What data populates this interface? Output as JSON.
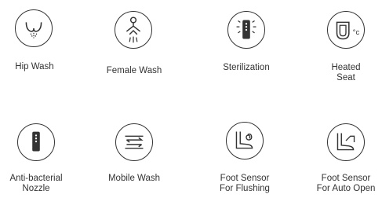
{
  "features": [
    {
      "icon": "hip-wash-icon",
      "label": "Hip Wash"
    },
    {
      "icon": "female-wash-icon",
      "label": "Female Wash"
    },
    {
      "icon": "sterilization-icon",
      "label": "Sterilization"
    },
    {
      "icon": "heated-seat-icon",
      "label_line1": "Heated",
      "label_line2": "Seat"
    },
    {
      "icon": "anti-bacterial-nozzle-icon",
      "label_line1": "Anti-bacterial",
      "label_line2": "Nozzle"
    },
    {
      "icon": "mobile-wash-icon",
      "label": "Mobile Wash"
    },
    {
      "icon": "foot-sensor-flushing-icon",
      "label_line1": "Foot Sensor",
      "label_line2": "For Flushing"
    },
    {
      "icon": "foot-sensor-auto-open-icon",
      "label_line1": "Foot Sensor",
      "label_line2": "For Auto Open"
    }
  ]
}
